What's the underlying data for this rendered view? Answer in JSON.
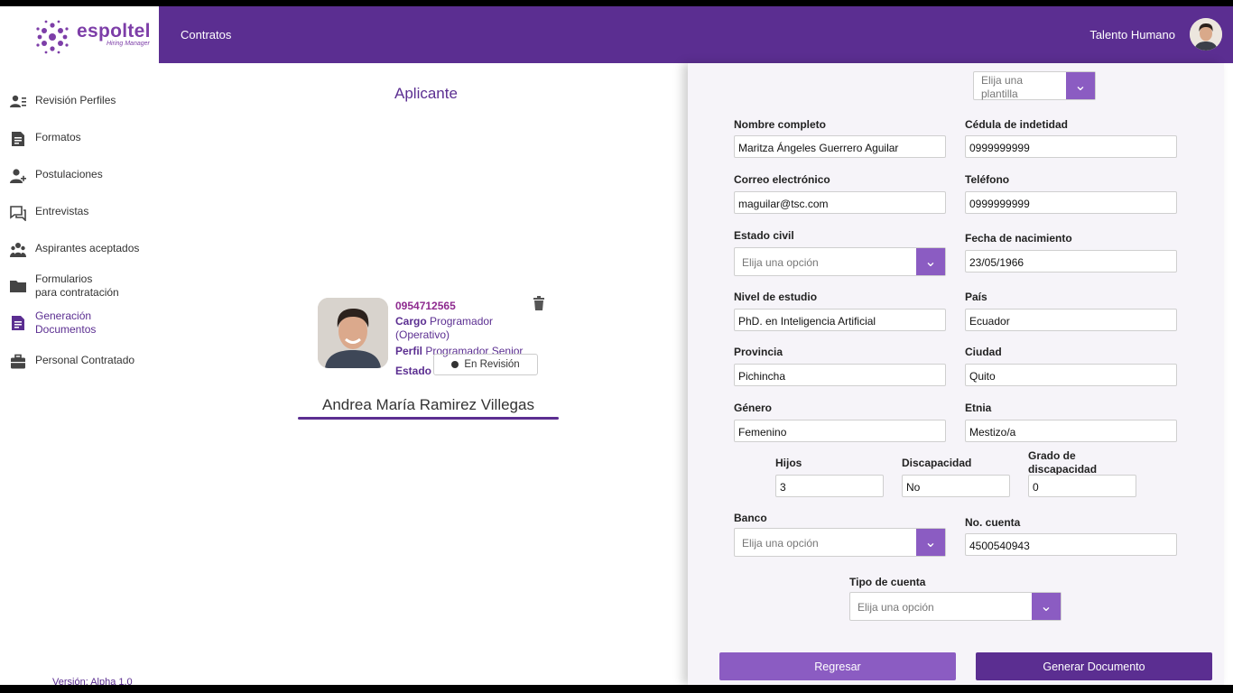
{
  "brand": {
    "name": "espoltel",
    "tagline": "Hiring Manager"
  },
  "header": {
    "nav_item": "Contratos",
    "user_role": "Talento Humano"
  },
  "sidebar": {
    "items": [
      {
        "label": "Revisión Perfiles",
        "icon": "user-list-icon"
      },
      {
        "label": "Formatos",
        "icon": "document-icon"
      },
      {
        "label": "Postulaciones",
        "icon": "user-add-icon"
      },
      {
        "label": "Entrevistas",
        "icon": "chat-icon"
      },
      {
        "label": "Aspirantes aceptados",
        "icon": "group-icon"
      },
      {
        "label": "Formularios\npara contratación",
        "icon": "folder-icon"
      },
      {
        "label": "Generación\nDocumentos",
        "icon": "document-edit-icon",
        "active": true
      },
      {
        "label": "Personal Contratado",
        "icon": "briefcase-icon"
      }
    ],
    "version": "Versión: Alpha 1.0"
  },
  "applicant": {
    "section_title": "Aplicante",
    "id": "0954712565",
    "cargo_label": "Cargo",
    "cargo_value": "Programador (Operativo)",
    "perfil_label": "Perfil",
    "perfil_value": "Programador Senior",
    "estado_label": "Estado",
    "estado_value": "En Revisión",
    "name": "Andrea María Ramirez Villegas"
  },
  "form": {
    "template_select": "Elija una plantilla",
    "nombre_label": "Nombre completo",
    "nombre_value": "Maritza Ángeles Guerrero Aguilar",
    "cedula_label": "Cédula de indetidad",
    "cedula_value": "0999999999",
    "correo_label": "Correo electrónico",
    "correo_value": "maguilar@tsc.com",
    "telefono_label": "Teléfono",
    "telefono_value": "0999999999",
    "estado_civil_label": "Estado civil",
    "estado_civil_placeholder": "Elija una opción",
    "fecha_label": "Fecha de nacimiento",
    "fecha_value": "23/05/1966",
    "nivel_label": "Nivel de estudio",
    "nivel_value": "PhD. en Inteligencia Artificial",
    "pais_label": "País",
    "pais_value": "Ecuador",
    "provincia_label": "Provincia",
    "provincia_value": "Pichincha",
    "ciudad_label": "Ciudad",
    "ciudad_value": "Quito",
    "genero_label": "Género",
    "genero_value": "Femenino",
    "etnia_label": "Etnia",
    "etnia_value": "Mestizo/a",
    "hijos_label": "Hijos",
    "hijos_value": "3",
    "discapacidad_label": "Discapacidad",
    "discapacidad_value": "No",
    "grado_label": "Grado de discapacidad",
    "grado_value": "0",
    "banco_label": "Banco",
    "banco_placeholder": "Elija una opción",
    "cuenta_label": "No. cuenta",
    "cuenta_value": "4500540943",
    "tipo_label": "Tipo de cuenta",
    "tipo_placeholder": "Elija una opción"
  },
  "actions": {
    "back": "Regresar",
    "generate": "Generar Documento"
  },
  "colors": {
    "primary": "#5b2e91",
    "accent": "#8b5cc2",
    "brand": "#7d3ea8"
  }
}
